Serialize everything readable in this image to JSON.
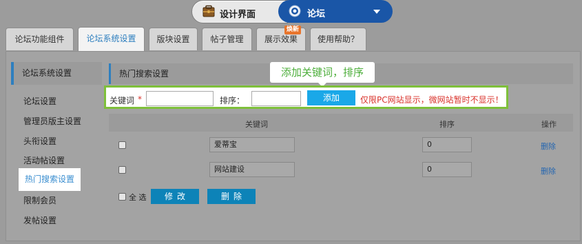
{
  "top_toggle": {
    "left_label": "设计界面",
    "left_icon": "toolbox-icon",
    "right_label": "论坛",
    "right_icon": "gear-icon",
    "right_color": "#1a56a7"
  },
  "tabs": [
    {
      "label": "论坛功能组件",
      "active": false
    },
    {
      "label": "论坛系统设置",
      "active": true
    },
    {
      "label": "版块设置",
      "active": false
    },
    {
      "label": "帖子管理",
      "active": false
    },
    {
      "label": "展示效果",
      "active": false,
      "badge": "焕新"
    },
    {
      "label": "使用帮助？",
      "active": false
    }
  ],
  "sidebar": {
    "title": "论坛系统设置",
    "items": [
      {
        "label": "论坛设置"
      },
      {
        "label": "管理员版主设置"
      },
      {
        "label": "头衔设置"
      },
      {
        "label": "活动帖设置"
      },
      {
        "label": "热门搜索设置",
        "active": true
      },
      {
        "label": "限制会员"
      },
      {
        "label": "发帖设置"
      }
    ]
  },
  "section_title": "热门搜索设置",
  "callout_text": "添加关键词，排序",
  "form": {
    "keyword_label": "关键词",
    "required_mark": "*",
    "keyword_value": "",
    "sort_label": "排序：",
    "sort_value": "",
    "add_label": "添加",
    "note": "仅限PC网站显示，微网站暂时不显示！"
  },
  "table": {
    "headers": {
      "keyword": "关键词",
      "sort": "排序",
      "action": "操作"
    },
    "rows": [
      {
        "keyword": "爱蒂宝",
        "sort": "0",
        "action": "删除",
        "checked": false
      },
      {
        "keyword": "网站建设",
        "sort": "0",
        "action": "删除",
        "checked": false
      }
    ]
  },
  "footer": {
    "select_all_label": "全 选",
    "modify_label": "修改",
    "delete_label": "删除"
  },
  "colors": {
    "accent_blue": "#2e7fbf",
    "add_button": "#1aa8e8",
    "action_button": "#0d83b8",
    "callout_green": "#4cae3a",
    "form_border": "#7ec03a",
    "note_red": "#d9322b",
    "badge_orange": "#e8742b"
  }
}
